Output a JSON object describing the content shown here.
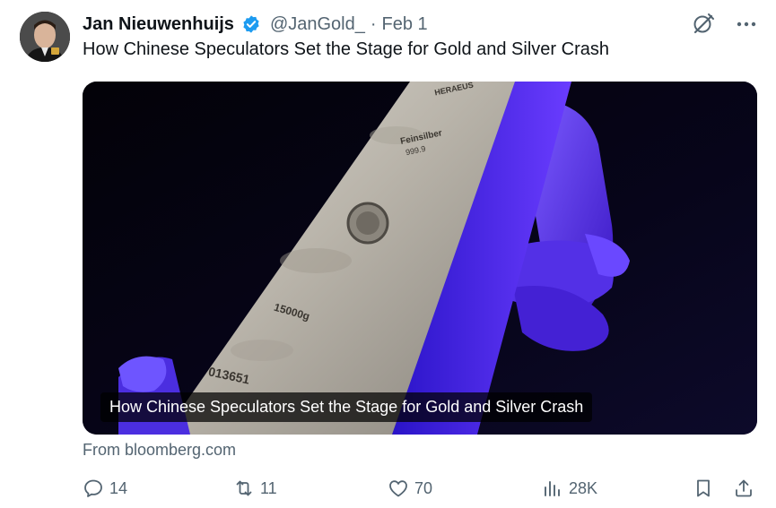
{
  "author": {
    "name": "Jan Nieuwenhuijs",
    "handle": "@JanGold_",
    "separator": "·",
    "date": "Feb 1"
  },
  "tweet": {
    "text": "How Chinese Speculators Set the Stage for Gold and Silver Crash"
  },
  "card": {
    "caption": "How Chinese Speculators Set the Stage for Gold and Silver Crash",
    "source": "From bloomberg.com",
    "bar_stamp_1": "HERAEUS",
    "bar_stamp_2": "Feinsilber",
    "bar_stamp_3": "999.9",
    "bar_stamp_4": "15000g",
    "bar_stamp_5": "013651"
  },
  "stats": {
    "replies": "14",
    "retweets": "11",
    "likes": "70",
    "views": "28K"
  },
  "colors": {
    "accent": "#1d9bf0",
    "muted": "#536471",
    "glove": "#5b2df0"
  },
  "icons": {
    "grok": "grok-icon",
    "more": "more-icon",
    "reply": "reply-icon",
    "retweet": "retweet-icon",
    "like": "heart-icon",
    "views": "views-icon",
    "bookmark": "bookmark-icon",
    "share": "share-icon"
  }
}
